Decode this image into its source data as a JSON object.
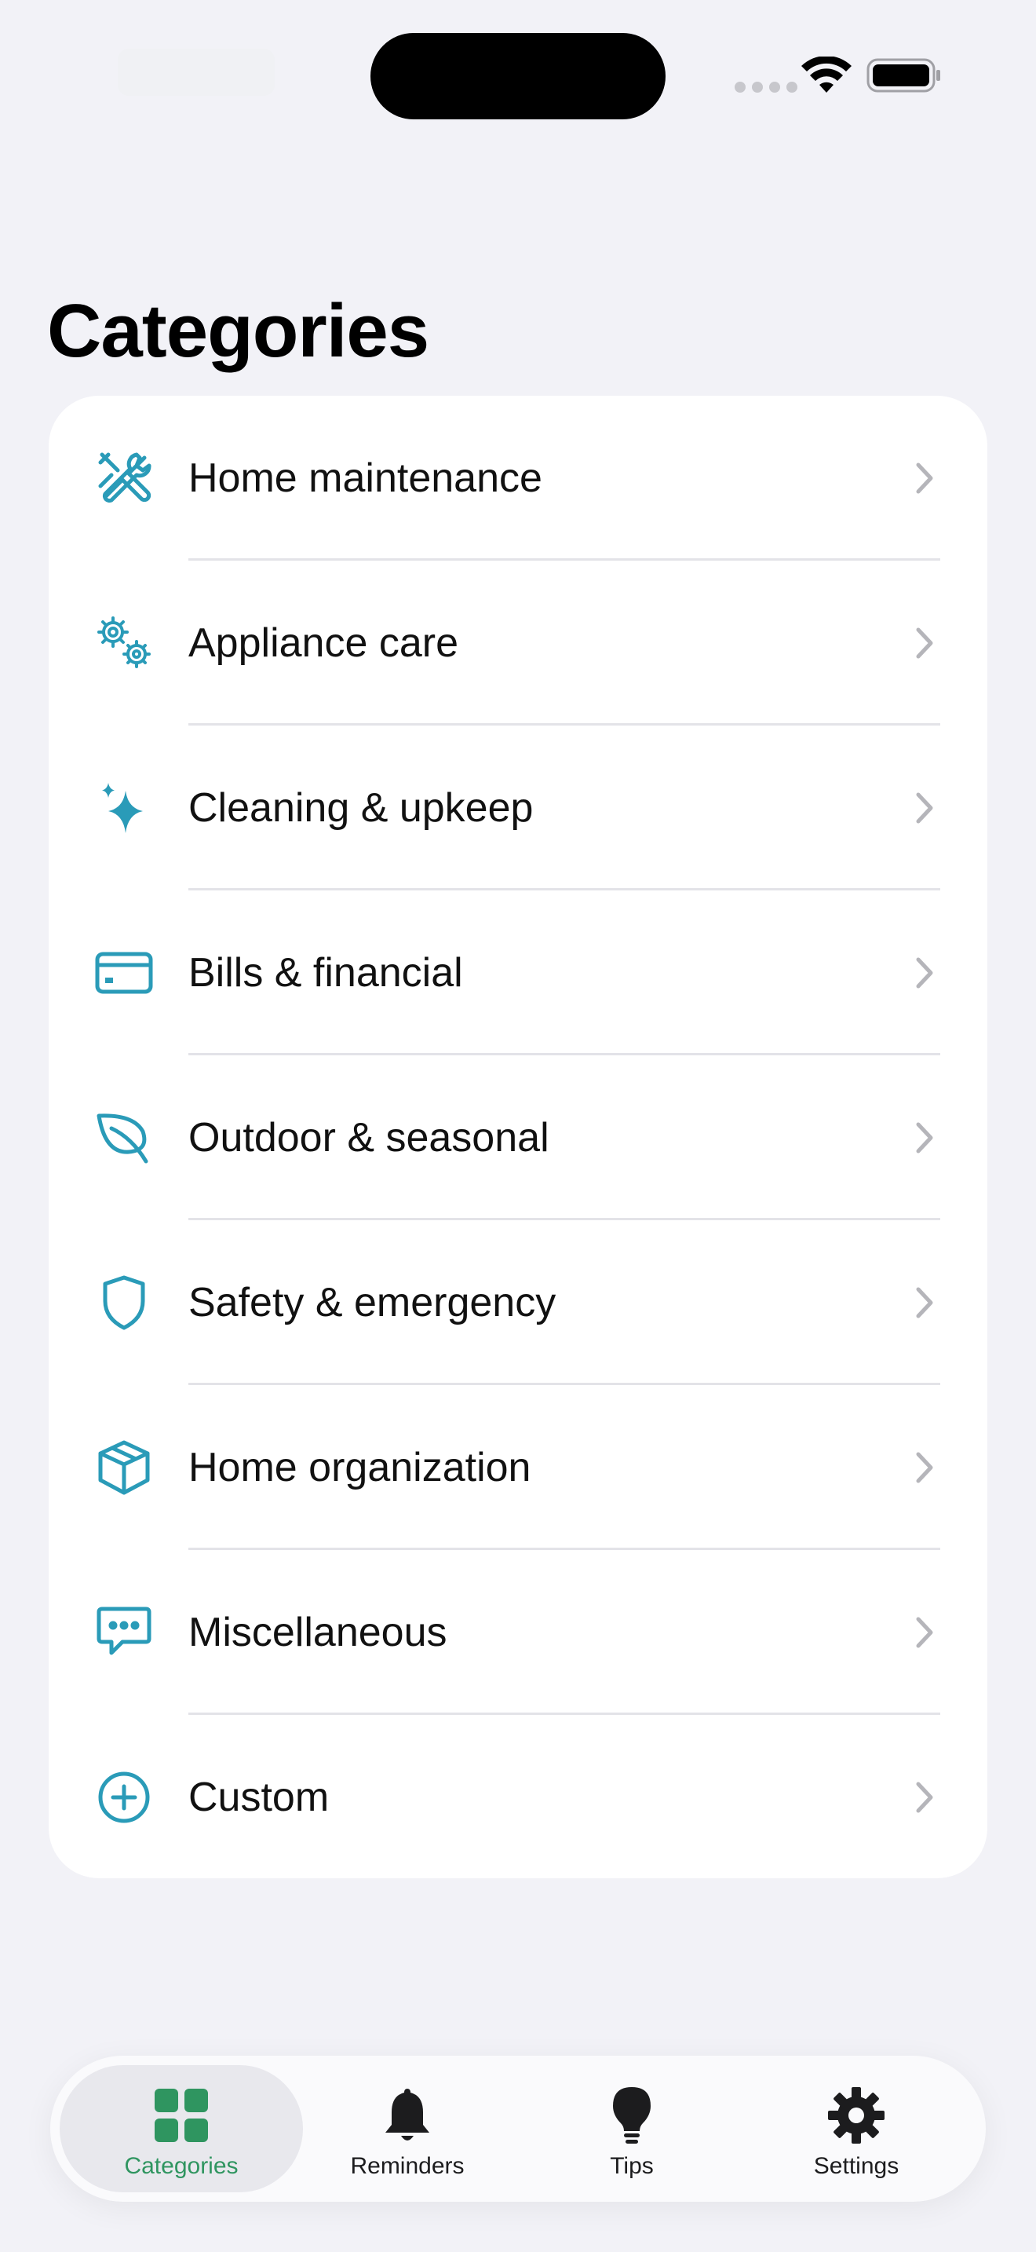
{
  "page": {
    "title": "Categories"
  },
  "colors": {
    "accent": "#2a9bb8",
    "tab_active": "#2f9560",
    "chevron": "#b5b5ba"
  },
  "categories": [
    {
      "label": "Home maintenance",
      "icon": "tools-icon"
    },
    {
      "label": "Appliance care",
      "icon": "gears-icon"
    },
    {
      "label": "Cleaning & upkeep",
      "icon": "sparkles-icon"
    },
    {
      "label": "Bills & financial",
      "icon": "credit-card-icon"
    },
    {
      "label": "Outdoor & seasonal",
      "icon": "leaf-icon"
    },
    {
      "label": "Safety & emergency",
      "icon": "shield-icon"
    },
    {
      "label": "Home organization",
      "icon": "box-icon"
    },
    {
      "label": "Miscellaneous",
      "icon": "chat-bubble-icon"
    },
    {
      "label": "Custom",
      "icon": "plus-circle-icon"
    }
  ],
  "tabs": [
    {
      "label": "Categories",
      "icon": "grid-icon",
      "active": true
    },
    {
      "label": "Reminders",
      "icon": "bell-icon",
      "active": false
    },
    {
      "label": "Tips",
      "icon": "lightbulb-icon",
      "active": false
    },
    {
      "label": "Settings",
      "icon": "gear-icon",
      "active": false
    }
  ]
}
